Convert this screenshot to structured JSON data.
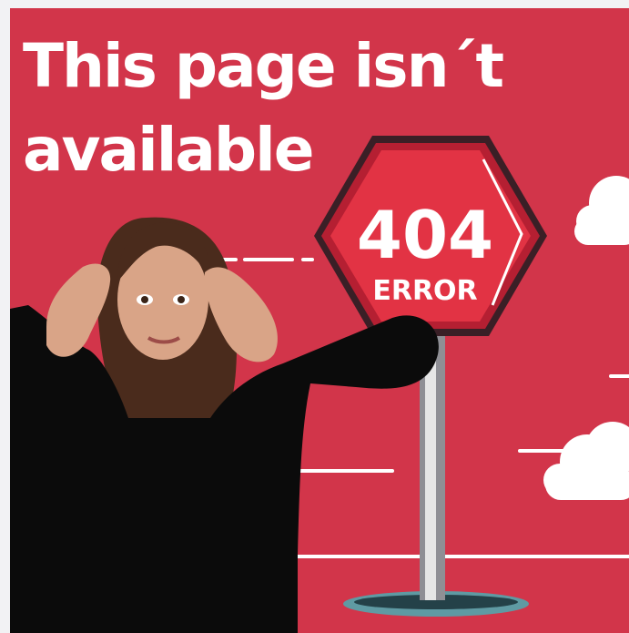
{
  "title": {
    "line1": "This page isn´t",
    "line2": "available"
  },
  "sign": {
    "code": "404",
    "word": "ERROR"
  },
  "colors": {
    "background": "#d2354a",
    "sign_red": "#e23344",
    "sign_dark_rim": "#3a1f26",
    "pole": "#d9d9d9",
    "hole": "#5f9aa3",
    "cloud": "#ffffff",
    "shirt": "#0b0b0b",
    "hair": "#4a2b1c",
    "skin": "#d9a487"
  },
  "icons": [
    "cloud-icon",
    "stop-sign-icon"
  ]
}
